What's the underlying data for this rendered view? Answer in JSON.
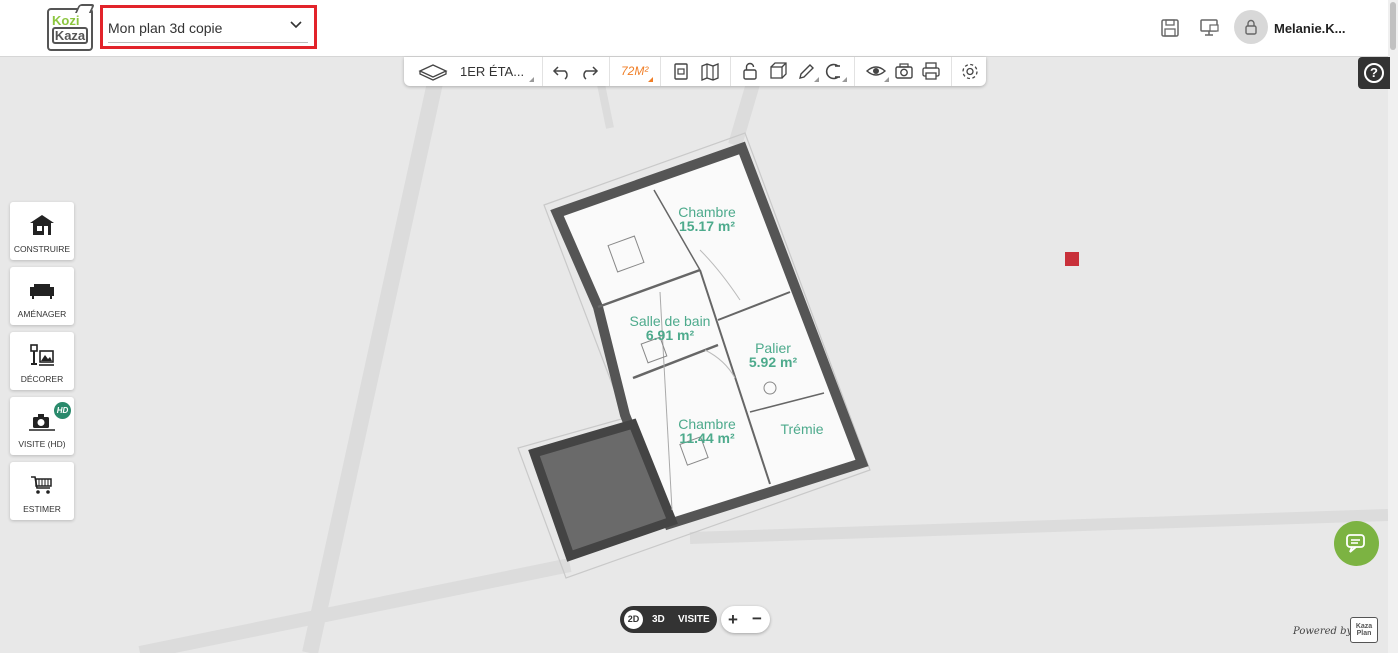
{
  "app": {
    "logo_top": "Kozi",
    "logo_bottom": "Kaza",
    "plan_name": "Mon plan 3d copie",
    "user_name": "Melanie.K...",
    "accent_color": "#e2232a",
    "brand_green": "#8cc63f"
  },
  "header_icons": [
    "save-icon",
    "screen-icon",
    "lock-icon"
  ],
  "toolbar": {
    "floor": "1ER ÉTA...",
    "area": "72M²",
    "icons": [
      "floor-3d-icon",
      "undo-icon",
      "redo-icon",
      "area-icon",
      "document-icon",
      "map-icon",
      "unlock-icon",
      "cube-icon",
      "pencil-icon",
      "magnet-icon",
      "eye-icon",
      "camera-icon",
      "print-icon",
      "settings-icon"
    ]
  },
  "help": {
    "label": "?"
  },
  "sidebar": {
    "items": [
      {
        "label": "CONSTRUIRE",
        "icon": "house-icon"
      },
      {
        "label": "AMÉNAGER",
        "icon": "sofa-icon"
      },
      {
        "label": "DÉCORER",
        "icon": "lamp-picture-icon"
      },
      {
        "label": "VISITE (HD)",
        "icon": "camera-hd-icon",
        "badge": "HD"
      },
      {
        "label": "ESTIMER",
        "icon": "cart-icon"
      }
    ]
  },
  "rooms": [
    {
      "name": "Chambre",
      "area": "15.17 m²"
    },
    {
      "name": "Salle de bain",
      "area": "6.91 m²"
    },
    {
      "name": "Palier",
      "area": "5.92 m²"
    },
    {
      "name": "Chambre",
      "area": "11.44 m²"
    },
    {
      "name": "Trémie",
      "area": ""
    }
  ],
  "view": {
    "mode_2d": "2D",
    "mode_3d": "3D",
    "mode_visit": "VISITE",
    "zoom_in": "+",
    "zoom_out": "−"
  },
  "footer": {
    "powered_by": "Powered by",
    "brand_top": "Kaza",
    "brand_bottom": "Plan"
  }
}
